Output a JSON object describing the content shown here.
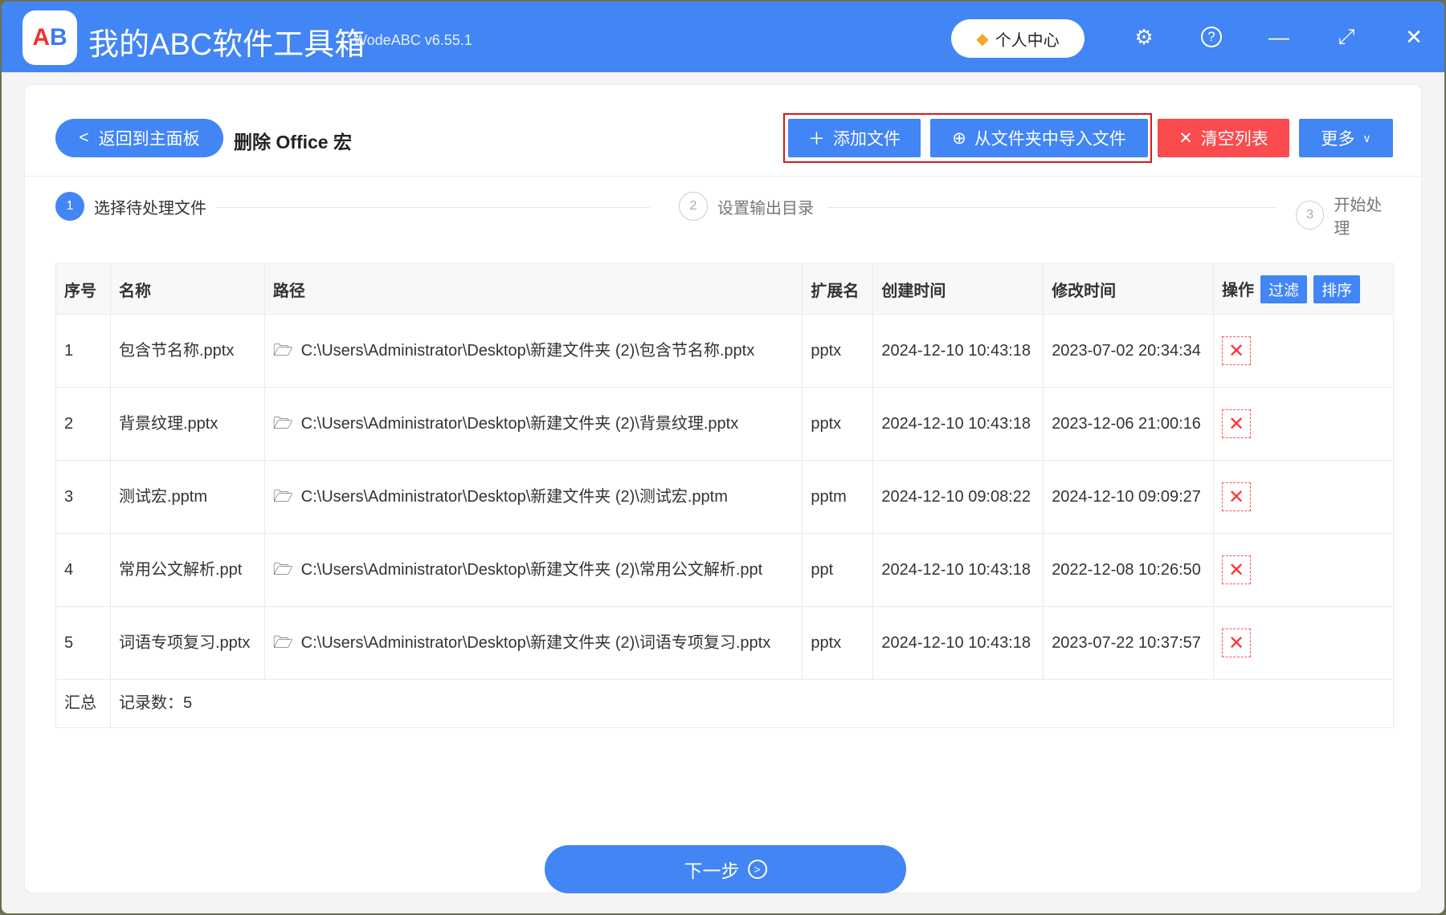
{
  "app": {
    "title": "我的ABC软件工具箱",
    "version": "WodeABC v6.55.1",
    "logo_text": "AB",
    "user_center": "个人中心"
  },
  "header": {
    "back": "返回到主面板",
    "title": "删除 Office 宏",
    "add_file": "添加文件",
    "import_folder": "从文件夹中导入文件",
    "clear_list": "清空列表",
    "more": "更多"
  },
  "steps": [
    {
      "num": "1",
      "label": "选择待处理文件"
    },
    {
      "num": "2",
      "label": "设置输出目录"
    },
    {
      "num": "3",
      "label": "开始处理"
    }
  ],
  "table": {
    "headers": {
      "index": "序号",
      "name": "名称",
      "path": "路径",
      "ext": "扩展名",
      "created": "创建时间",
      "modified": "修改时间",
      "action": "操作",
      "filter": "过滤",
      "sort": "排序"
    },
    "rows": [
      {
        "index": "1",
        "name": "包含节名称.pptx",
        "path": "C:\\Users\\Administrator\\Desktop\\新建文件夹 (2)\\包含节名称.pptx",
        "ext": "pptx",
        "created": "2024-12-10 10:43:18",
        "modified": "2023-07-02 20:34:34"
      },
      {
        "index": "2",
        "name": "背景纹理.pptx",
        "path": "C:\\Users\\Administrator\\Desktop\\新建文件夹 (2)\\背景纹理.pptx",
        "ext": "pptx",
        "created": "2024-12-10 10:43:18",
        "modified": "2023-12-06 21:00:16"
      },
      {
        "index": "3",
        "name": "测试宏.pptm",
        "path": "C:\\Users\\Administrator\\Desktop\\新建文件夹 (2)\\测试宏.pptm",
        "ext": "pptm",
        "created": "2024-12-10 09:08:22",
        "modified": "2024-12-10 09:09:27"
      },
      {
        "index": "4",
        "name": "常用公文解析.ppt",
        "path": "C:\\Users\\Administrator\\Desktop\\新建文件夹 (2)\\常用公文解析.ppt",
        "ext": "ppt",
        "created": "2024-12-10 10:43:18",
        "modified": "2022-12-08 10:26:50"
      },
      {
        "index": "5",
        "name": "词语专项复习.pptx",
        "path": "C:\\Users\\Administrator\\Desktop\\新建文件夹 (2)\\词语专项复习.pptx",
        "ext": "pptx",
        "created": "2024-12-10 10:43:18",
        "modified": "2023-07-22 10:37:57"
      }
    ],
    "summary_label": "汇总",
    "summary_value": "记录数：5"
  },
  "footer": {
    "next": "下一步"
  }
}
